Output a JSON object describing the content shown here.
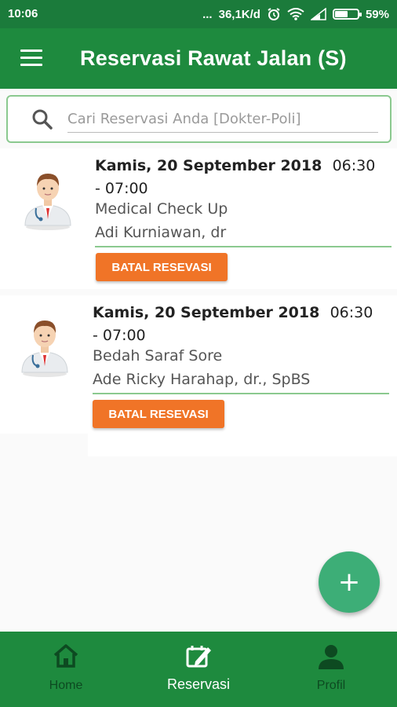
{
  "status_bar": {
    "time": "10:06",
    "network_speed": "36,1K/d",
    "battery_percent": "59%",
    "battery_level": 0.59
  },
  "app_bar": {
    "title": "Reservasi Rawat Jalan (S)"
  },
  "search": {
    "placeholder": "Cari Reservasi Anda [Dokter-Poli]",
    "value": ""
  },
  "reservations": [
    {
      "date": "Kamis, 20 September 2018",
      "time": "06:30 - 07:00",
      "poli": "Medical Check Up",
      "doctor": "Adi Kurniawan, dr",
      "cancel_label": "BATAL RESEVASI"
    },
    {
      "date": "Kamis, 20 September 2018",
      "time": "06:30 - 07:00",
      "poli": "Bedah Saraf Sore",
      "doctor": "Ade Ricky Harahap, dr., SpBS",
      "cancel_label": "BATAL RESEVASI"
    }
  ],
  "fab": {
    "label": "+"
  },
  "bottom_nav": {
    "items": [
      {
        "label": "Home",
        "icon": "home-icon"
      },
      {
        "label": "Reservasi",
        "icon": "edit-calendar-icon"
      },
      {
        "label": "Profil",
        "icon": "person-icon"
      }
    ],
    "active": "Reservasi"
  },
  "colors": {
    "primary": "#1e8a3e",
    "accent_button": "#f07427",
    "fab": "#3dae77"
  }
}
